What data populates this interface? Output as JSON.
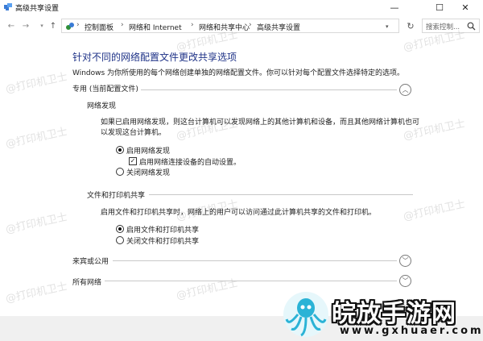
{
  "window": {
    "title": "高级共享设置"
  },
  "address_bar": {
    "breadcrumbs": [
      "控制面板",
      "网络和 Internet",
      "网络和共享中心",
      "高级共享设置"
    ],
    "search_placeholder": "搜索控制..."
  },
  "main": {
    "heading": "针对不同的网络配置文件更改共享选项",
    "description": "Windows 为你所使用的每个网络创建单独的网络配置文件。你可以针对每个配置文件选择特定的选项。",
    "profiles": [
      {
        "label": "专用 (当前配置文件)",
        "expanded": true,
        "sections": [
          {
            "title": "网络发现",
            "text": "如果已启用网络发现，则这台计算机可以发现网络上的其他计算机和设备，而且其他网络计算机也可以发现这台计算机。",
            "options": [
              {
                "label": "启用网络发现",
                "selected": true
              },
              {
                "label": "启用网络连接设备的自动设置。",
                "checked": true
              },
              {
                "label": "关闭网络发现",
                "selected": false
              }
            ]
          },
          {
            "title": "文件和打印机共享",
            "text": "启用文件和打印机共享时，网络上的用户可以访问通过此计算机共享的文件和打印机。",
            "options": [
              {
                "label": "启用文件和打印机共享",
                "selected": true
              },
              {
                "label": "关闭文件和打印机共享",
                "selected": false
              }
            ]
          }
        ]
      },
      {
        "label": "来宾或公用",
        "expanded": false
      },
      {
        "label": "所有网络",
        "expanded": false
      }
    ]
  },
  "watermark": {
    "text": "@打印机卫士"
  },
  "brand": {
    "name": "皖放手游网",
    "url": "www.gxhuaer.com"
  },
  "colors": {
    "heading": "#1e3287",
    "divider": "#c8c8c8",
    "bottom_strip": "#f0f0f0"
  }
}
